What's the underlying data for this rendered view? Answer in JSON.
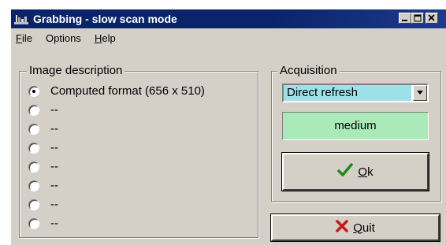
{
  "window": {
    "title": "Grabbing - slow scan mode"
  },
  "menu": {
    "file_first": "F",
    "file_rest": "ile",
    "options": "Options",
    "help_first": "H",
    "help_rest": "elp"
  },
  "image_description": {
    "title": "Image description",
    "selected_index": 0,
    "options": [
      "Computed format (656 x 510)",
      "--",
      "--",
      "--",
      "--",
      "--",
      "--",
      "--"
    ]
  },
  "acquisition": {
    "title": "Acquisition",
    "mode_value": "Direct refresh",
    "speed_value": "medium"
  },
  "buttons": {
    "ok_first": "O",
    "ok_rest": "k",
    "quit_first": "Q",
    "quit_rest": "uit"
  },
  "icons": {
    "app": "grab-app-icon",
    "ok": "check-icon",
    "quit": "x-icon"
  },
  "colors": {
    "titlebar": "#0a246a",
    "dialog_bg": "#d4d0c8",
    "select_highlight": "#9ee0e8",
    "status_bg": "#aaeab8",
    "ok_check": "#1a8a1a",
    "quit_x": "#c81818"
  }
}
